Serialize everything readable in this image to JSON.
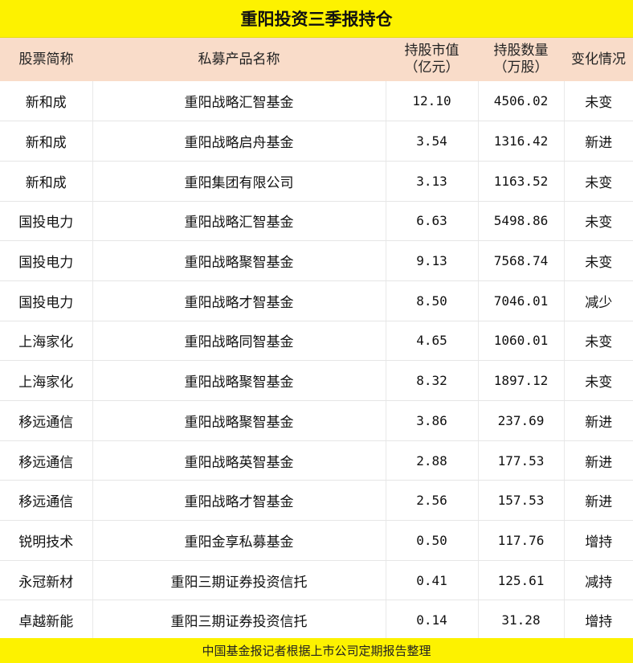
{
  "title": "重阳投资三季报持仓",
  "headers": {
    "stock": "股票简称",
    "product": "私募产品名称",
    "value_line1": "持股市值",
    "value_line2": "（亿元）",
    "qty_line1": "持股数量",
    "qty_line2": "（万股）",
    "change": "变化情况"
  },
  "rows": [
    {
      "stock": "新和成",
      "product": "重阳战略汇智基金",
      "value": "12.10",
      "qty": "4506.02",
      "change": "未变"
    },
    {
      "stock": "新和成",
      "product": "重阳战略启舟基金",
      "value": "3.54",
      "qty": "1316.42",
      "change": "新进"
    },
    {
      "stock": "新和成",
      "product": "重阳集团有限公司",
      "value": "3.13",
      "qty": "1163.52",
      "change": "未变"
    },
    {
      "stock": "国投电力",
      "product": "重阳战略汇智基金",
      "value": "6.63",
      "qty": "5498.86",
      "change": "未变"
    },
    {
      "stock": "国投电力",
      "product": "重阳战略聚智基金",
      "value": "9.13",
      "qty": "7568.74",
      "change": "未变"
    },
    {
      "stock": "国投电力",
      "product": "重阳战略才智基金",
      "value": "8.50",
      "qty": "7046.01",
      "change": "减少"
    },
    {
      "stock": "上海家化",
      "product": "重阳战略同智基金",
      "value": "4.65",
      "qty": "1060.01",
      "change": "未变"
    },
    {
      "stock": "上海家化",
      "product": "重阳战略聚智基金",
      "value": "8.32",
      "qty": "1897.12",
      "change": "未变"
    },
    {
      "stock": "移远通信",
      "product": "重阳战略聚智基金",
      "value": "3.86",
      "qty": "237.69",
      "change": "新进"
    },
    {
      "stock": "移远通信",
      "product": "重阳战略英智基金",
      "value": "2.88",
      "qty": "177.53",
      "change": "新进"
    },
    {
      "stock": "移远通信",
      "product": "重阳战略才智基金",
      "value": "2.56",
      "qty": "157.53",
      "change": "新进"
    },
    {
      "stock": "锐明技术",
      "product": "重阳金享私募基金",
      "value": "0.50",
      "qty": "117.76",
      "change": "增持"
    },
    {
      "stock": "永冠新材",
      "product": "重阳三期证券投资信托",
      "value": "0.41",
      "qty": "125.61",
      "change": "减持"
    },
    {
      "stock": "卓越新能",
      "product": "重阳三期证券投资信托",
      "value": "0.14",
      "qty": "31.28",
      "change": "增持"
    }
  ],
  "footer": "中国基金报记者根据上市公司定期报告整理",
  "colors": {
    "title_bg": "#fdf200",
    "header_bg": "#f9dcc9",
    "footer_bg": "#fdf200"
  }
}
